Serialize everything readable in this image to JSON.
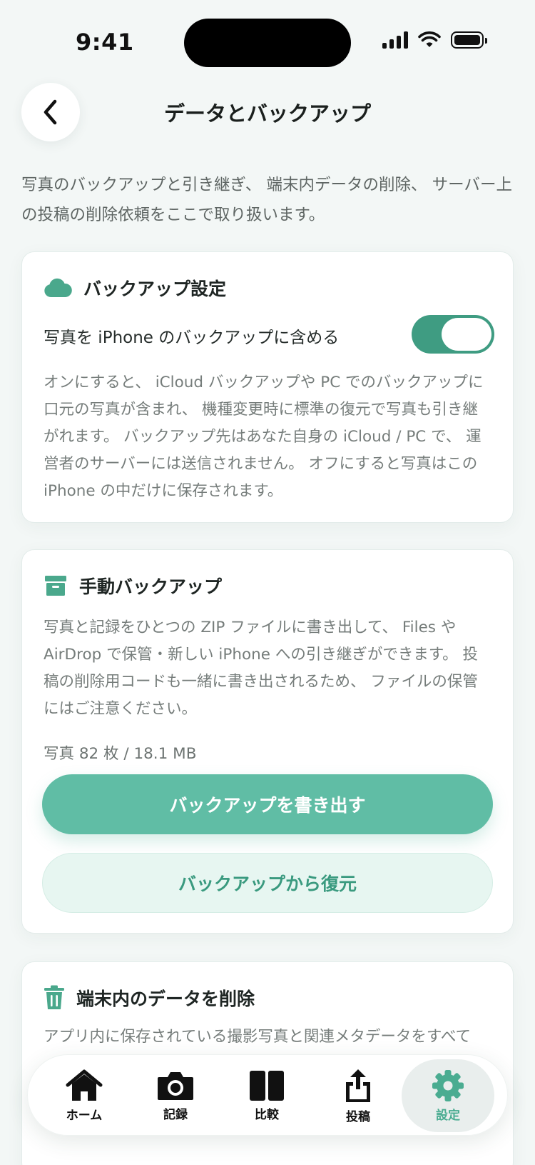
{
  "status_bar": {
    "time": "9:41"
  },
  "header": {
    "title": "データとバックアップ"
  },
  "intro": "写真のバックアップと引き継ぎ、 端末内データの削除、 サーバー上の投稿の削除依頼をここで取り扱います。",
  "backup_settings": {
    "title": "バックアップ設定",
    "icon": "cloud-icon",
    "toggle_label": "写真を iPhone のバックアップに含める",
    "toggle_on": true,
    "description": "オンにすると、 iCloud バックアップや PC でのバックアップに口元の写真が含まれ、 機種変更時に標準の復元で写真も引き継がれます。 バックアップ先はあなた自身の iCloud / PC で、 運営者のサーバーには送信されません。 オフにすると写真はこの iPhone の中だけに保存されます。"
  },
  "manual_backup": {
    "title": "手動バックアップ",
    "icon": "archive-icon",
    "description": "写真と記録をひとつの ZIP ファイルに書き出して、 Files や AirDrop で保管・新しい iPhone への引き継ぎができます。 投稿の削除用コードも一緒に書き出されるため、 ファイルの保管にはご注意ください。",
    "stats": "写真 82 枚 / 18.1 MB",
    "export_label": "バックアップを書き出す",
    "restore_label": "バックアップから復元"
  },
  "delete_data": {
    "title": "端末内のデータを削除",
    "icon": "trash-icon",
    "description": "アプリ内に保存されている撮影写真と関連メタデータをすべて"
  },
  "tab_bar": {
    "active": "settings",
    "items": [
      {
        "id": "home",
        "label": "ホーム",
        "icon": "home-icon"
      },
      {
        "id": "record",
        "label": "記録",
        "icon": "camera-icon"
      },
      {
        "id": "compare",
        "label": "比較",
        "icon": "compare-icon"
      },
      {
        "id": "post",
        "label": "投稿",
        "icon": "share-icon"
      },
      {
        "id": "settings",
        "label": "設定",
        "icon": "gear-icon"
      }
    ]
  },
  "colors": {
    "accent": "#60bda5",
    "accent_dark": "#3f9c82",
    "background": "#f3f7f6"
  }
}
